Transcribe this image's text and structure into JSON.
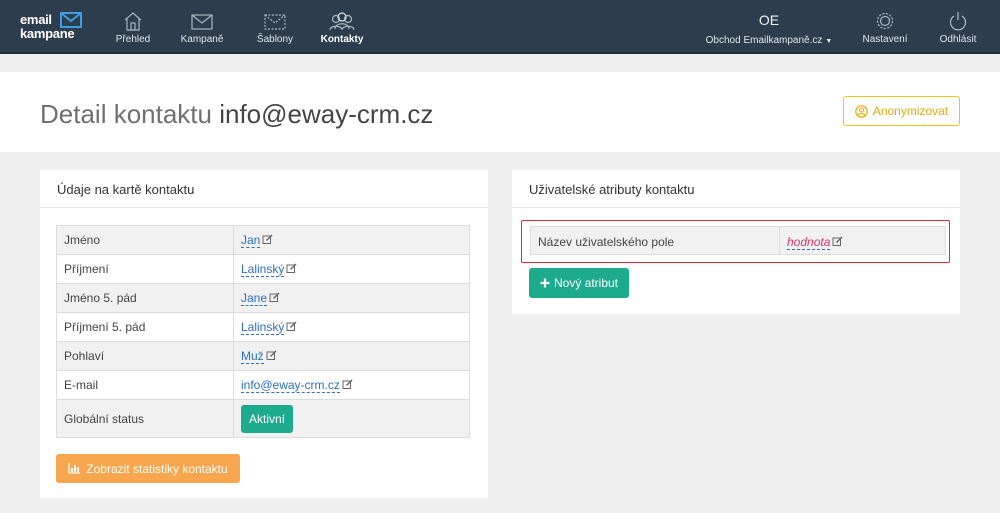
{
  "brand": {
    "line1": "email",
    "line2": "kampane"
  },
  "nav": {
    "items": [
      {
        "label": "Přehled",
        "icon": "home-icon"
      },
      {
        "label": "Kampaně",
        "icon": "envelope-icon"
      },
      {
        "label": "Šablony",
        "icon": "template-icon"
      },
      {
        "label": "Kontakty",
        "icon": "contacts-icon",
        "active": true
      }
    ],
    "store": {
      "initials": "OE",
      "label": "Obchod Emailkampaně.cz"
    },
    "settings_label": "Nastavení",
    "logout_label": "Odhlásit"
  },
  "page": {
    "title_prefix": "Detail kontaktu",
    "title_email": "info@eway-crm.cz",
    "anonymize_label": "Anonymizovat"
  },
  "contact_panel": {
    "heading": "Údaje na kartě kontaktu",
    "rows": [
      {
        "key": "Jméno",
        "value": "Jan"
      },
      {
        "key": "Příjmení",
        "value": "Lalinský"
      },
      {
        "key": "Jméno 5. pád",
        "value": "Jane"
      },
      {
        "key": "Příjmení 5. pád",
        "value": "Lalinský"
      },
      {
        "key": "Pohlaví",
        "value": "Muž"
      },
      {
        "key": "E-mail",
        "value": "info@eway-crm.cz"
      }
    ],
    "status_key": "Globální status",
    "status_value": "Aktivní",
    "stats_button": "Zobrazit statistiky kontaktu"
  },
  "attributes_panel": {
    "heading": "Uživatelské atributy kontaktu",
    "attr_key": "Název uživatelského pole",
    "attr_value": "hodnota",
    "new_button": "Nový atribut"
  },
  "colors": {
    "topbar": "#2e3d4d",
    "link": "#2d6fc1",
    "green": "#1dab8d",
    "orange": "#f7a64e",
    "yellow": "#f0c419",
    "highlight": "#d62d3a"
  }
}
